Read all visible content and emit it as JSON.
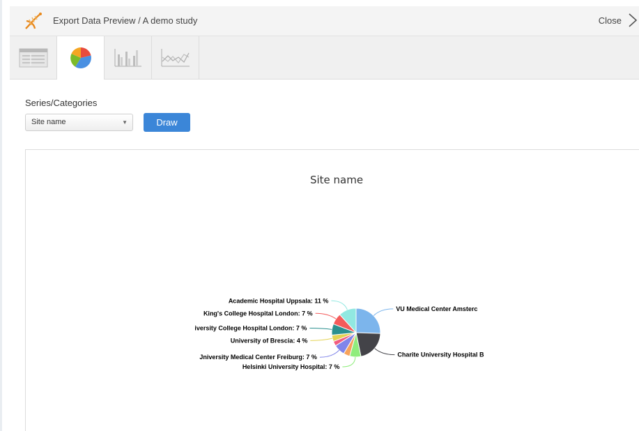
{
  "header": {
    "title": "Export Data Preview / A demo study",
    "close_label": "Close"
  },
  "tabs": [
    {
      "name": "table-view",
      "icon": "table-icon",
      "active": false
    },
    {
      "name": "pie-chart",
      "icon": "pie-chart-icon",
      "active": true
    },
    {
      "name": "bar-chart",
      "icon": "bar-chart-icon",
      "active": false
    },
    {
      "name": "line-chart",
      "icon": "line-chart-icon",
      "active": false
    }
  ],
  "controls": {
    "series_label": "Series/Categories",
    "selected_series": "Site name",
    "draw_label": "Draw"
  },
  "chart_data": {
    "type": "pie",
    "title": "Site name",
    "slices": [
      {
        "label": "VU Medical Center Amsterc",
        "value": 24,
        "color": "#7cb5ec"
      },
      {
        "label": "Charite University Hospital B",
        "value": 20,
        "color": "#434348"
      },
      {
        "label": "Helsinki University Hospital: 7 %",
        "value": 7,
        "color": "#90ed7d"
      },
      {
        "label": "",
        "value": 4,
        "color": "#f7a35c"
      },
      {
        "label": "Jniversity Medical Center Freiburg: 7 %",
        "value": 7,
        "color": "#8085e9"
      },
      {
        "label": "",
        "value": 3,
        "color": "#f15c80"
      },
      {
        "label": "University of Brescia: 4 %",
        "value": 4,
        "color": "#e4d354"
      },
      {
        "label": "iversity College Hospital London: 7 %",
        "value": 7,
        "color": "#2b908f"
      },
      {
        "label": "King's College Hospital London: 7 %",
        "value": 7,
        "color": "#f45b5b"
      },
      {
        "label": "Academic Hospital Uppsala: 11 %",
        "value": 11,
        "color": "#91e8e1"
      }
    ]
  }
}
